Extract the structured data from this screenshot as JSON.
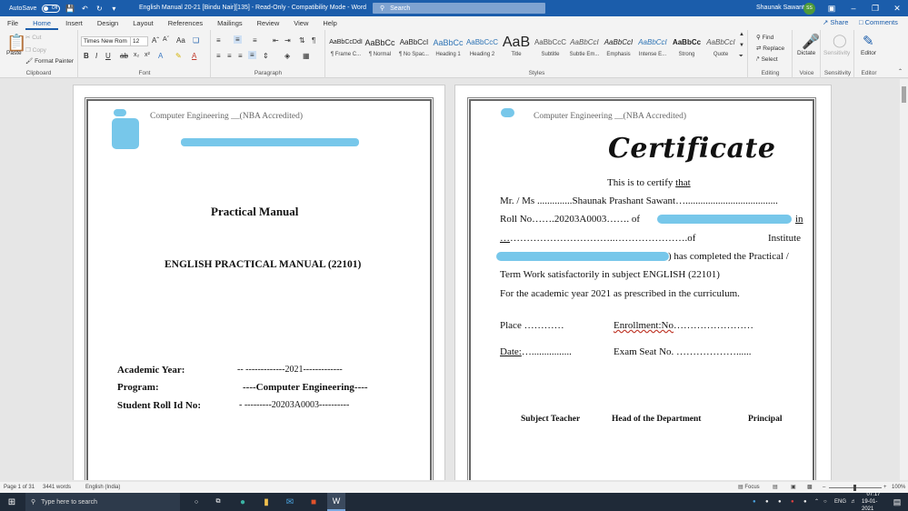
{
  "titlebar": {
    "autosave_label": "AutoSave",
    "autosave_state": "Off",
    "doc_title": "English Manual 20-21 [Bindu Nair][135]  -  Read-Only  -  Compatibility Mode  -  Word",
    "search_placeholder": "Search",
    "user_name": "Shaunak Sawant",
    "user_initials": "SS"
  },
  "tabs": [
    "File",
    "Home",
    "Insert",
    "Design",
    "Layout",
    "References",
    "Mailings",
    "Review",
    "View",
    "Help"
  ],
  "active_tab": "Home",
  "share_label": "Share",
  "comments_label": "Comments",
  "ribbon": {
    "clipboard": {
      "paste": "Paste",
      "cut": "Cut",
      "copy": "Copy",
      "format_painter": "Format Painter",
      "label": "Clipboard"
    },
    "font": {
      "name": "Times New Rom",
      "size": "12",
      "label": "Font"
    },
    "paragraph": {
      "label": "Paragraph"
    },
    "styles": {
      "label": "Styles",
      "items": [
        {
          "sample": "AaBbCcDdI",
          "name": "¶ Frame C..."
        },
        {
          "sample": "AaBbCc",
          "name": "¶ Normal"
        },
        {
          "sample": "AaBbCcI",
          "name": "¶ No Spac..."
        },
        {
          "sample": "AaBbCc",
          "name": "Heading 1"
        },
        {
          "sample": "AaBbCcC",
          "name": "Heading 2"
        },
        {
          "sample": "AaB",
          "name": "Title"
        },
        {
          "sample": "AaBbCcC",
          "name": "Subtitle"
        },
        {
          "sample": "AaBbCcI",
          "name": "Subtle Em..."
        },
        {
          "sample": "AaBbCcI",
          "name": "Emphasis"
        },
        {
          "sample": "AaBbCcI",
          "name": "Intense E..."
        },
        {
          "sample": "AaBbCc",
          "name": "Strong"
        },
        {
          "sample": "AaBbCcI",
          "name": "Quote"
        }
      ]
    },
    "editing": {
      "find": "Find",
      "replace": "Replace",
      "select": "Select",
      "label": "Editing"
    },
    "voice": {
      "dictate": "Dictate",
      "label": "Voice"
    },
    "sensitivity": {
      "button": "Sensitivity",
      "label": "Sensitivity"
    },
    "editor": {
      "button": "Editor",
      "label": "Editor"
    }
  },
  "page1": {
    "header": "Computer Engineering   __(NBA Accredited)",
    "title": "Practical Manual",
    "subtitle": "ENGLISH PRACTICAL MANUAL (22101)",
    "rows": [
      {
        "label": "Academic Year:",
        "value": "-- -------------2021-------------"
      },
      {
        "label": "Program:",
        "value": "----Computer Engineering----"
      },
      {
        "label": "Student Roll Id No:",
        "value": "- ---------20203A0003----------"
      }
    ]
  },
  "page2": {
    "header": "Computer Engineering   __(NBA Accredited)",
    "cert_title": "Certificate",
    "line1_a": "This is to certify ",
    "line1_b": "that",
    "line2": "Mr. / Ms ..............Shaunak Prashant Sawant….....................................",
    "line3_a": "Roll   No…….20203A0003…….   of",
    "line3_b": "in",
    "line4_a": "…",
    "line4_b": "…………………………..………………….of",
    "line4_c": "Institute",
    "line5": ") has completed the Practical /",
    "line6": "Term Work satisfactorily in subject ENGLISH (22101)",
    "line7": " For the academic year 2021 as prescribed in the curriculum.",
    "place": "Place …………",
    "enrollment_a": "Enrollment:No",
    "enrollment_b": "……………………",
    "date_a": "Date:",
    "date_b": "…................",
    "exam_seat": "Exam Seat No. ………………......",
    "sig1": "Subject Teacher",
    "sig2": "Head of the Department",
    "sig3": "Principal"
  },
  "statusbar": {
    "page": "Page 1 of 31",
    "words": "3441 words",
    "language": "English (India)",
    "focus": "Focus",
    "zoom": "100%"
  },
  "taskbar": {
    "search_placeholder": "Type here to search",
    "language": "ENG",
    "time": "07:17",
    "date": "19-01-2021"
  }
}
